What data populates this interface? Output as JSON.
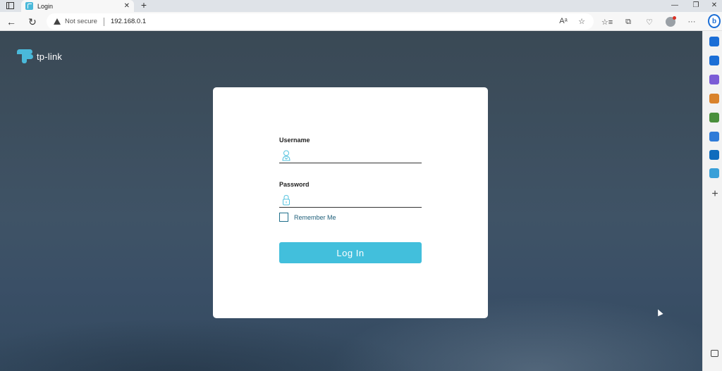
{
  "browser": {
    "tab": {
      "title": "Login",
      "close_glyph": "✕"
    },
    "new_tab_glyph": "+",
    "window_controls": {
      "minimize": "—",
      "restore": "❐",
      "close": "✕"
    },
    "address": {
      "security_label": "Not secure",
      "url": "192.168.0.1"
    },
    "icons": {
      "back": "←",
      "reload": "↻",
      "read_aloud": "Aᵃ",
      "favorite": "☆",
      "favorites_list": "☆≡",
      "collections": "⧉",
      "extensions": "♡",
      "more": "···",
      "bing": "b",
      "add_sidebar": "+"
    },
    "sidebar_colors": [
      "#1b6ed6",
      "#1b6ed6",
      "#7b5cd6",
      "#d9822b",
      "#4a8f3c",
      "#2f7bd8",
      "#0f6cbd",
      "#3aa0d8"
    ]
  },
  "brand": {
    "name": "tp-link",
    "color": "#4ab9da"
  },
  "login": {
    "username_label": "Username",
    "username_value": "",
    "password_label": "Password",
    "password_value": "",
    "remember_label": "Remember Me",
    "remember_checked": false,
    "submit_label": "Log In",
    "accent": "#42bfdc"
  }
}
